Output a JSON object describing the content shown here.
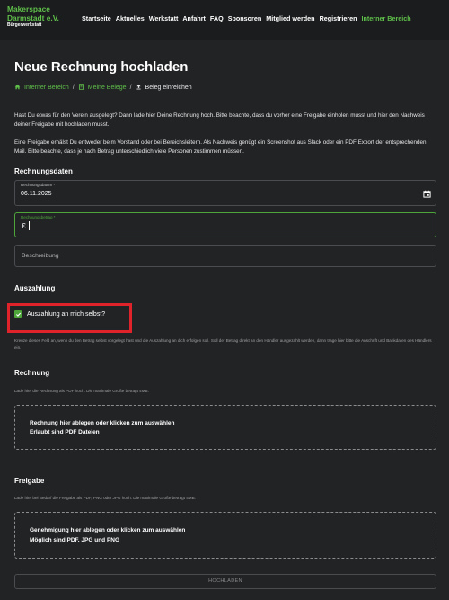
{
  "brand": {
    "line1": "Makerspace",
    "line2": "Darmstadt e.V.",
    "sub": "Bürgerwerkstatt"
  },
  "nav": [
    "Startseite",
    "Aktuelles",
    "Werkstatt",
    "Anfahrt",
    "FAQ",
    "Sponsoren",
    "Mitglied werden",
    "Registrieren",
    "Interner Bereich"
  ],
  "page_title": "Neue Rechnung hochladen",
  "breadcrumb": {
    "item1": "Interner Bereich",
    "item2": "Meine Belege",
    "current": "Beleg einreichen",
    "sep": "/"
  },
  "intro1": "Hast Du etwas für den Verein ausgelegt? Dann lade hier Deine Rechnung hoch. Bitte beachte, dass du vorher eine Freigabe einholen musst und hier den Nachweis deiner Freigabe mit hochladen musst.",
  "intro2": "Eine Freigabe erhälst Du entweder beim Vorstand oder bei Bereichsleitern. Als Nachweis genügt ein Screenshot aus Slack oder ein PDF Export der entsprechenden Mail. Bitte beachte, dass je nach Betrag unterschiedlich viele Personen zustimmen müssen.",
  "section_invoice_data": "Rechnungsdaten",
  "date_field": {
    "label": "Rechnungsdatum *",
    "value": "06.11.2025"
  },
  "amount_field": {
    "label": "Rechnungsbetrag *",
    "prefix": "€",
    "value": ""
  },
  "description_field": {
    "placeholder": "Beschreibung"
  },
  "section_payout": "Auszahlung",
  "payout_checkbox": {
    "label": "Auszahlung an mich selbst?",
    "checked": true
  },
  "payout_help": "Kreuze dieses Feld an, wenn du den Betrag selbst vorgelegt hast und die Auszahlung an dich erfolgen soll. Soll der Betrag direkt an den Händler ausgezahlt werden, dann trage hier bitte die Anschrift und Bankdaten des Händlers ein.",
  "section_invoice": "Rechnung",
  "invoice_help": "Lade hier die Rechnung als PDF hoch. Die maximale Größe beträgt 4MB.",
  "invoice_drop": {
    "line1": "Rechnung hier ablegen oder klicken zum auswählen",
    "line2": "Erlaubt sind PDF Dateien"
  },
  "section_approval": "Freigabe",
  "approval_help": "Lade hier bei Bedarf die Freigabe als PDF, PNG oder JPG hoch. Die maximale Größe beträgt 4MB.",
  "approval_drop": {
    "line1": "Genehmigung hier ablegen oder klicken zum auswählen",
    "line2": "Möglich sind PDF, JPG und PNG"
  },
  "upload_button": "HOCHLADEN",
  "colors": {
    "accent": "#5fbf4a",
    "highlight": "#e0232a",
    "background": "#222325"
  }
}
